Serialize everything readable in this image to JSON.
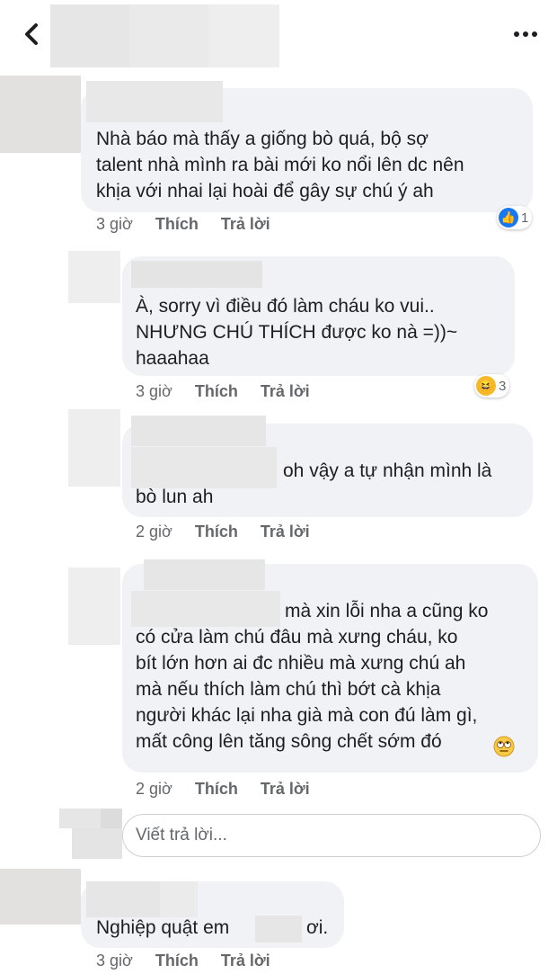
{
  "header": {
    "back_icon": "chevron-left-icon",
    "more_icon": "more-horizontal-icon"
  },
  "comments": [
    {
      "text_lines": [
        "Nhà báo mà thấy a giống bò quá, bộ sợ",
        "talent nhà mình ra bài mới ko nổi lên dc nên",
        "khịa với nhai lại hoài để gây sự chú ý ah"
      ],
      "time": "3 giờ",
      "like": "Thích",
      "reply": "Trả lời",
      "reaction": {
        "icon": "like-icon",
        "count": "1",
        "color": "#1877f2"
      }
    }
  ],
  "replies": [
    {
      "text_lines": [
        "À, sorry vì điều đó làm cháu ko vui..",
        "NHƯNG CHÚ THÍCH được ko nà =))~",
        "haaahaa"
      ],
      "time": "3 giờ",
      "like": "Thích",
      "reply": "Trả lời",
      "reaction": {
        "icon": "laugh-icon",
        "count": "3",
        "color": "#f7b928"
      }
    },
    {
      "text_lines": [
        "oh vậy a tự nhận mình là",
        "bò lun ah"
      ],
      "time": "2 giờ",
      "like": "Thích",
      "reply": "Trả lời"
    },
    {
      "text_lines": [
        "mà xin lỗi nha a cũng ko",
        "có cửa làm chú đâu mà xưng cháu, ko",
        "bít lớn hơn ai đc nhiều mà xưng chú ah",
        "mà nếu thích làm chú thì bớt cà khịa",
        "người khác lại nha già mà con đú làm gì,",
        "mất công lên tăng sông chết sớm đó"
      ],
      "emoji": "eye-roll-emoji",
      "time": "2 giờ",
      "like": "Thích",
      "reply": "Trả lời"
    }
  ],
  "reply_input": {
    "placeholder": "Viết trả lời..."
  },
  "last_comment": {
    "text_before": "Nghiệp quật em",
    "text_after": "ơi.",
    "time": "3 giờ",
    "like": "Thích",
    "reply": "Trả lời"
  }
}
